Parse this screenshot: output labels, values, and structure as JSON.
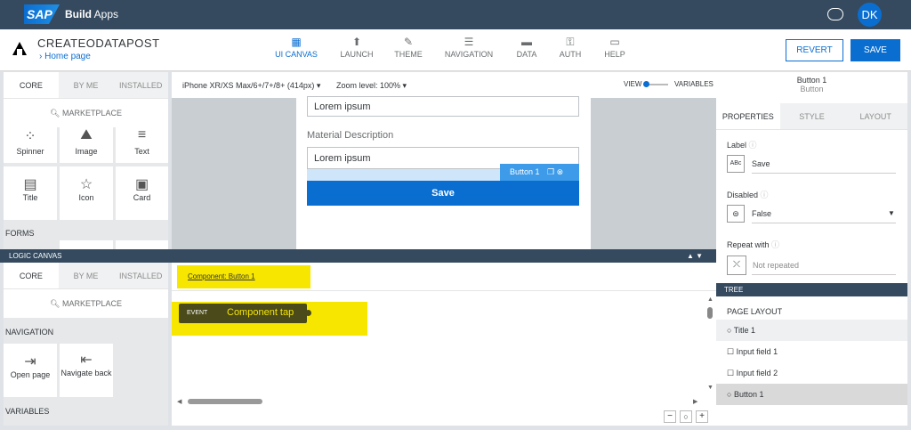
{
  "shell": {
    "logo": "SAP",
    "title_bold": "Build",
    "title": "Apps",
    "avatar": "DK"
  },
  "app": {
    "name": "CREATEODATAPOST",
    "breadcrumb": "Home page"
  },
  "nav": [
    {
      "label": "UI CANVAS",
      "icon": "▦"
    },
    {
      "label": "LAUNCH",
      "icon": "⬆"
    },
    {
      "label": "THEME",
      "icon": "✎"
    },
    {
      "label": "NAVIGATION",
      "icon": "☰"
    },
    {
      "label": "DATA",
      "icon": "▬"
    },
    {
      "label": "AUTH",
      "icon": "⚿"
    },
    {
      "label": "HELP",
      "icon": "▭"
    }
  ],
  "actions": {
    "revert": "REVERT",
    "save": "SAVE"
  },
  "palette": {
    "tabs": [
      "CORE",
      "BY ME",
      "INSTALLED"
    ],
    "marketplace": "MARKETPLACE",
    "components": [
      "Spinner",
      "Image",
      "Text",
      "Title",
      "Icon",
      "Card"
    ],
    "forms": "FORMS"
  },
  "toolbar": {
    "device": "iPhone XR/XS Max/6+/7+/8+ (414px)",
    "zoom": "Zoom level: 100%",
    "view": "VIEW",
    "variables": "VARIABLES"
  },
  "canvas": {
    "field1_value": "Lorem ipsum",
    "label2": "Material Description",
    "field2_value": "Lorem ipsum",
    "button_tag": "Button 1",
    "button_label": "Save"
  },
  "logic": {
    "header": "LOGIC CANVAS",
    "tabs": [
      "CORE",
      "BY ME",
      "INSTALLED"
    ],
    "marketplace": "MARKETPLACE",
    "navigation": "NAVIGATION",
    "nodes": [
      "Open page",
      "Navigate back"
    ],
    "variables": "VARIABLES",
    "component_link": "Component: Button 1",
    "event_tag": "EVENT",
    "event_label": "Component tap"
  },
  "props": {
    "title": "Button 1",
    "subtitle": "Button",
    "tabs": [
      "PROPERTIES",
      "STYLE",
      "LAYOUT"
    ],
    "label_title": "Label",
    "label_value": "Save",
    "disabled_title": "Disabled",
    "disabled_value": "False",
    "repeat_title": "Repeat with",
    "repeat_value": "Not repeated"
  },
  "tree": {
    "header": "TREE",
    "section": "PAGE LAYOUT",
    "items": [
      "Title 1",
      "Input field 1",
      "Input field 2",
      "Button 1"
    ]
  },
  "colors": {
    "accent": "#0a6ed1",
    "shell": "#354a5f",
    "highlight": "#f7e600"
  }
}
